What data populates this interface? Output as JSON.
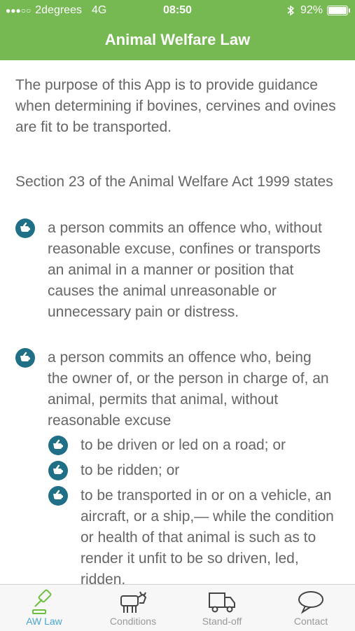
{
  "status_bar": {
    "signal": "●●●○○",
    "carrier": "2degrees",
    "network": "4G",
    "time": "08:50",
    "battery": "92%",
    "battery_level": 0.92
  },
  "nav": {
    "title": "Animal Welfare Law"
  },
  "content": {
    "intro": "The purpose of this App is to provide guidance when determining if bovines, cervines and ovines are fit to be transported.",
    "section": "Section 23 of the Animal Welfare Act 1999 states",
    "bullets": [
      "a person commits an offence who, without reasonable excuse, confines or transports an animal in a manner or position that causes the animal unreasonable or unnecessary pain or distress.",
      "a person commits an offence who, being the owner of, or the person in charge of, an animal, permits that animal, without reasonable excuse"
    ],
    "sub_bullets": [
      "to be driven or led on a road; or",
      "to be ridden; or",
      "to be transported in or on a vehicle, an aircraft, or a ship,— while the condition or health of that animal is such as to render it unfit to be so driven, led, ridden,"
    ]
  },
  "tabs": [
    {
      "label": "AW Law",
      "icon": "gavel-icon",
      "active": true
    },
    {
      "label": "Conditions",
      "icon": "cow-icon"
    },
    {
      "label": "Stand-off",
      "icon": "truck-icon"
    },
    {
      "label": "Contact",
      "icon": "speech-bubble-icon"
    }
  ],
  "colors": {
    "header": "#76b852",
    "bullet_icon": "#1f6f86",
    "active_tab": "#4aa3d8",
    "text": "#666666"
  }
}
